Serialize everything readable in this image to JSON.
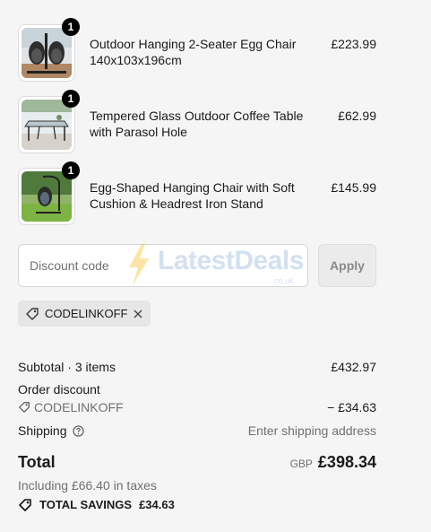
{
  "line_items": [
    {
      "title": "Outdoor Hanging 2-Seater Egg Chair 140x103x196cm",
      "price": "£223.99",
      "quantity": "1"
    },
    {
      "title": "Tempered Glass Outdoor Coffee Table with Parasol Hole",
      "price": "£62.99",
      "quantity": "1"
    },
    {
      "title": "Egg-Shaped Hanging Chair with Soft Cushion & Headrest Iron Stand",
      "price": "£145.99",
      "quantity": "1"
    }
  ],
  "discount": {
    "placeholder": "Discount code",
    "apply_label": "Apply",
    "applied_code": "CODELINKOFF"
  },
  "watermark": {
    "text": "LatestDeals",
    "subtext": "co.uk"
  },
  "summary": {
    "subtotal_label": "Subtotal · 3 items",
    "subtotal_value": "£432.97",
    "order_discount_label": "Order discount",
    "discount_code": "CODELINKOFF",
    "discount_value": "− £34.63",
    "shipping_label": "Shipping",
    "shipping_value": "Enter shipping address",
    "total_label": "Total",
    "total_currency": "GBP",
    "total_value": "£398.34",
    "tax_note": "Including £66.40 in taxes",
    "savings_label": "TOTAL SAVINGS",
    "savings_value": "£34.63"
  },
  "colors": {
    "background": "#f5f5f5",
    "badge": "#000000",
    "tag_bg": "#e6e6e6",
    "muted_text": "#707070"
  }
}
